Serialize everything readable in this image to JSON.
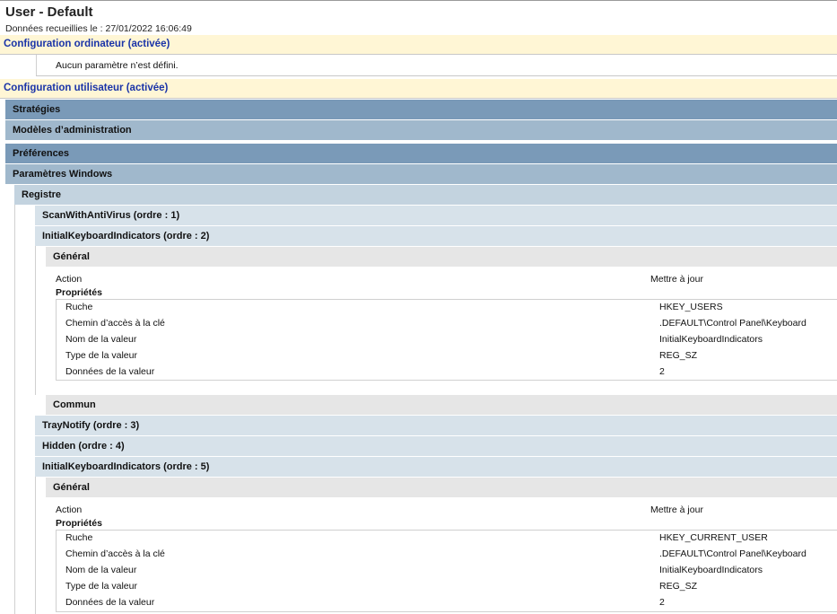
{
  "header": {
    "title": "User - Default",
    "collected": "Données recueillies le : 27/01/2022 16:06:49"
  },
  "computer_config": {
    "label": "Configuration ordinateur (activée)",
    "no_settings": "Aucun paramètre n’est défini."
  },
  "user_config": {
    "label": "Configuration utilisateur (activée)",
    "strategies": "Stratégies",
    "admin_templates": "Modèles d’administration",
    "preferences": "Préférences",
    "windows_settings": "Paramètres Windows",
    "registry": "Registre"
  },
  "items": {
    "scan": "ScanWithAntiVirus (ordre : 1)",
    "ikb2": "InitialKeyboardIndicators (ordre : 2)",
    "tray": "TrayNotify (ordre : 3)",
    "hidden": "Hidden (ordre : 4)",
    "ikb5": "InitialKeyboardIndicators (ordre : 5)"
  },
  "labels": {
    "general": "Général",
    "common": "Commun",
    "action": "Action",
    "update": "Mettre à jour",
    "properties": "Propriétés",
    "hive": "Ruche",
    "key_path": "Chemin d’accès à la clé",
    "value_name": "Nom de la valeur",
    "value_type": "Type de la valeur",
    "value_data": "Données de la valeur"
  },
  "block1": {
    "hive": "HKEY_USERS",
    "key_path": ".DEFAULT\\Control Panel\\Keyboard",
    "value_name": "InitialKeyboardIndicators",
    "value_type": "REG_SZ",
    "value_data": "2"
  },
  "block2": {
    "hive": "HKEY_CURRENT_USER",
    "key_path": ".DEFAULT\\Control Panel\\Keyboard",
    "value_name": "InitialKeyboardIndicators",
    "value_type": "REG_SZ",
    "value_data": "2"
  }
}
